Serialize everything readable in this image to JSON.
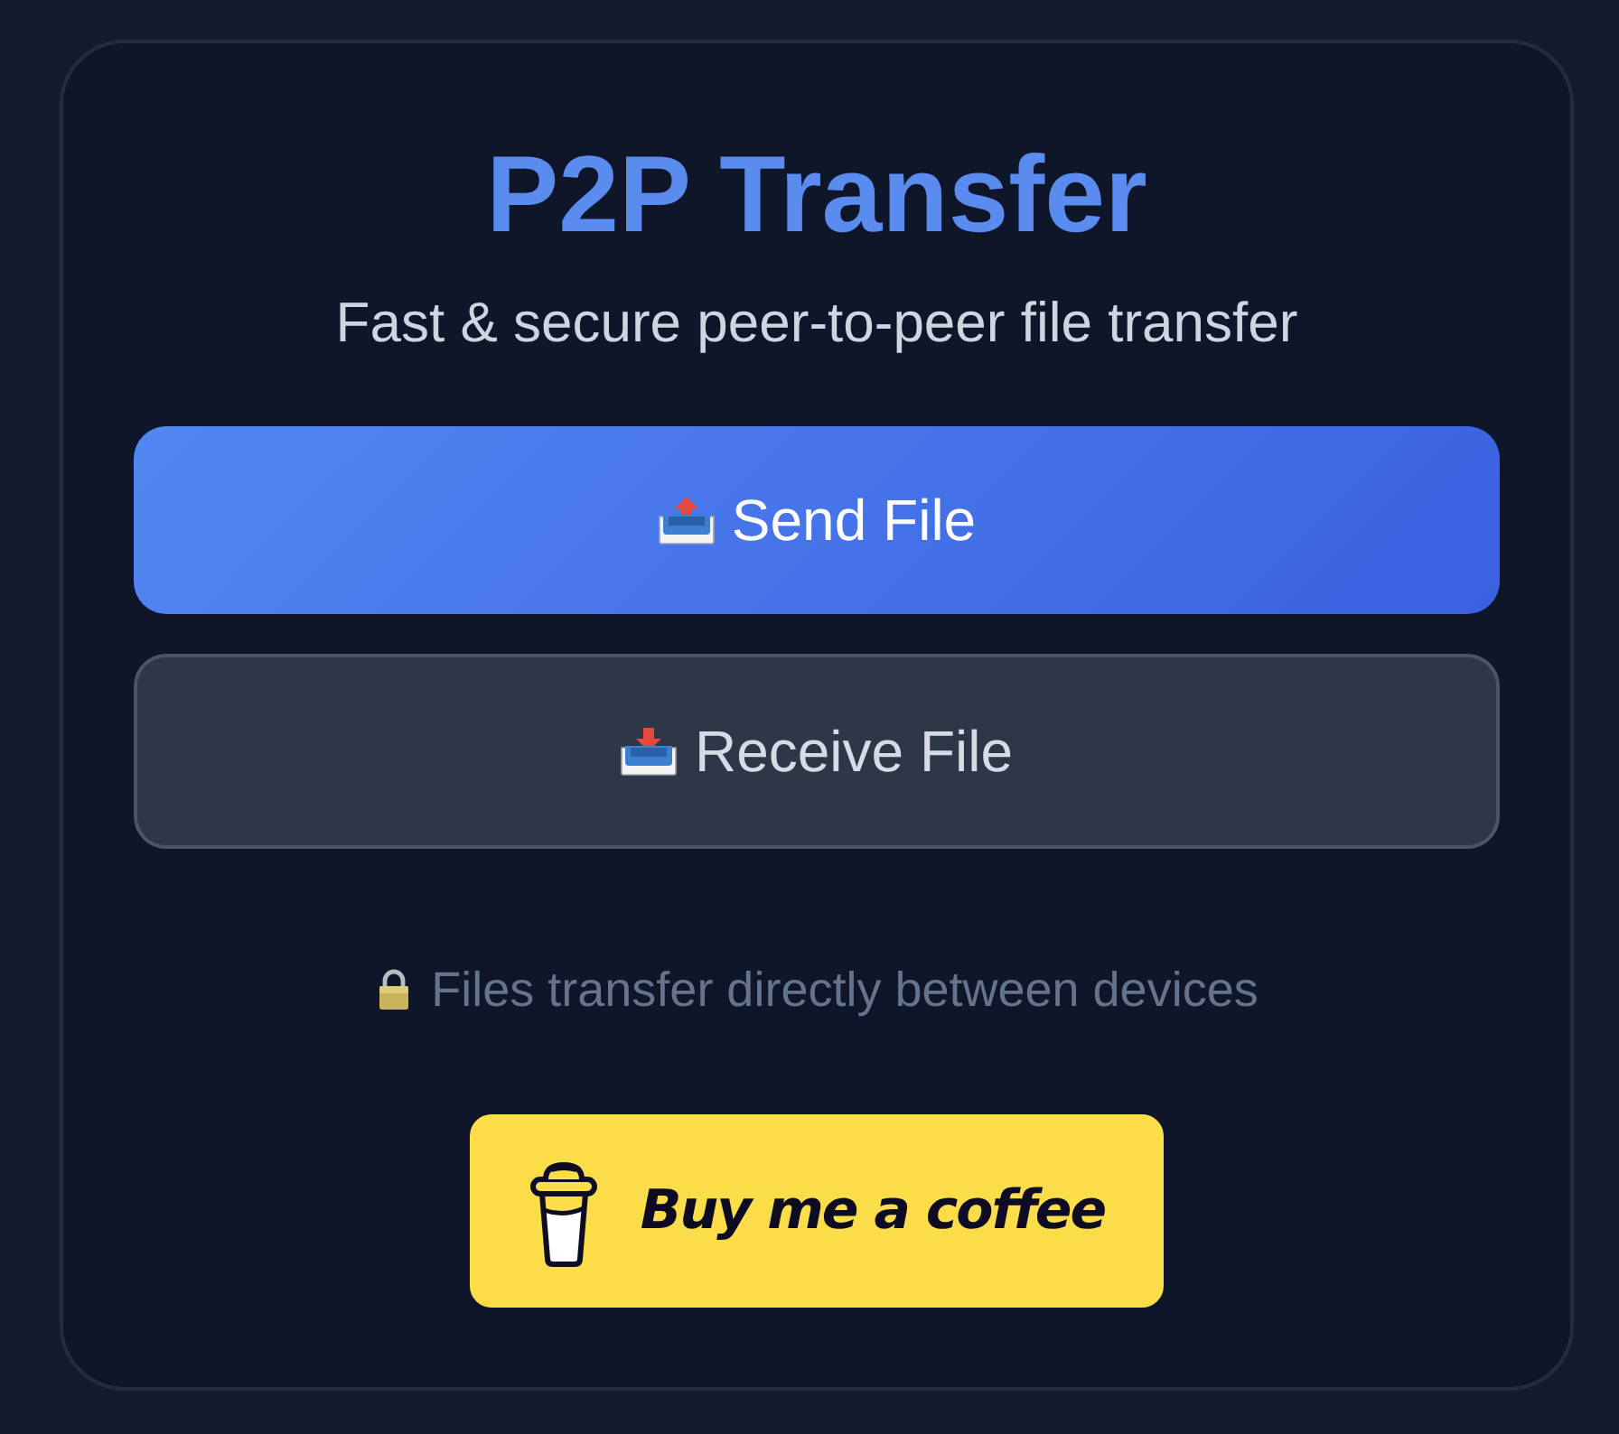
{
  "title": "P2P Transfer",
  "subtitle": "Fast & secure peer-to-peer file transfer",
  "actions": [
    {
      "kind": "send",
      "label": "Send File"
    },
    {
      "kind": "receive",
      "label": "Receive File"
    }
  ],
  "note": "Files transfer directly between devices",
  "donate_button": {
    "label": "Buy me a coffee"
  }
}
